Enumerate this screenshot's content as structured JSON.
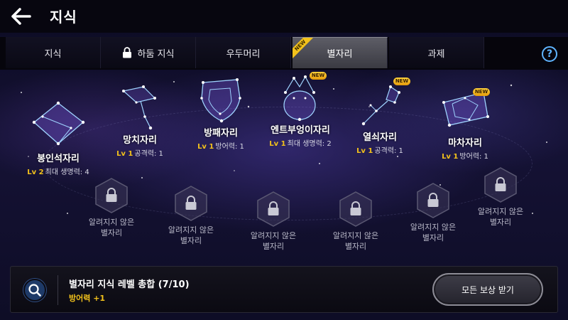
{
  "header": {
    "title": "지식"
  },
  "tabs": [
    {
      "label": "지식",
      "locked": false,
      "active": false,
      "new": false
    },
    {
      "label": "하둠 지식",
      "locked": true,
      "active": false,
      "new": false
    },
    {
      "label": "우두머리",
      "locked": false,
      "active": false,
      "new": false
    },
    {
      "label": "별자리",
      "locked": false,
      "active": true,
      "new": true
    },
    {
      "label": "과제",
      "locked": false,
      "active": false,
      "new": false
    }
  ],
  "help": {
    "label": "?"
  },
  "new_label": "NEW",
  "constellations": [
    {
      "name": "봉인석자리",
      "level": "Lv 2",
      "stat": "최대 생명력: 4",
      "new": false
    },
    {
      "name": "망치자리",
      "level": "Lv 1",
      "stat": "공격력: 1",
      "new": false
    },
    {
      "name": "방패자리",
      "level": "Lv 1",
      "stat": "방어력: 1",
      "new": false
    },
    {
      "name": "엔트부엉이자리",
      "level": "Lv 1",
      "stat": "최대 생명력: 2",
      "new": true
    },
    {
      "name": "열쇠자리",
      "level": "Lv 1",
      "stat": "공격력: 1",
      "new": true
    },
    {
      "name": "마차자리",
      "level": "Lv 1",
      "stat": "방어력: 1",
      "new": true
    }
  ],
  "unknown": [
    {
      "line1": "알려지지 않은",
      "line2": "별자리"
    },
    {
      "line1": "알려지지 않은",
      "line2": "별자리"
    },
    {
      "line1": "알려지지 않은",
      "line2": "별자리"
    },
    {
      "line1": "알려지지 않은",
      "line2": "별자리"
    },
    {
      "line1": "알려지지 않은",
      "line2": "별자리"
    },
    {
      "line1": "알려지지 않은",
      "line2": "별자리"
    }
  ],
  "summary": {
    "title": "별자리 지식 레벨 총합 (7/10)",
    "bonus": "방어력 +1",
    "claim_button": "모든 보상 받기"
  },
  "colors": {
    "accent_gold": "#f3c21b",
    "help_blue": "#5fb4ff",
    "star_blue": "#9fd4ff"
  }
}
